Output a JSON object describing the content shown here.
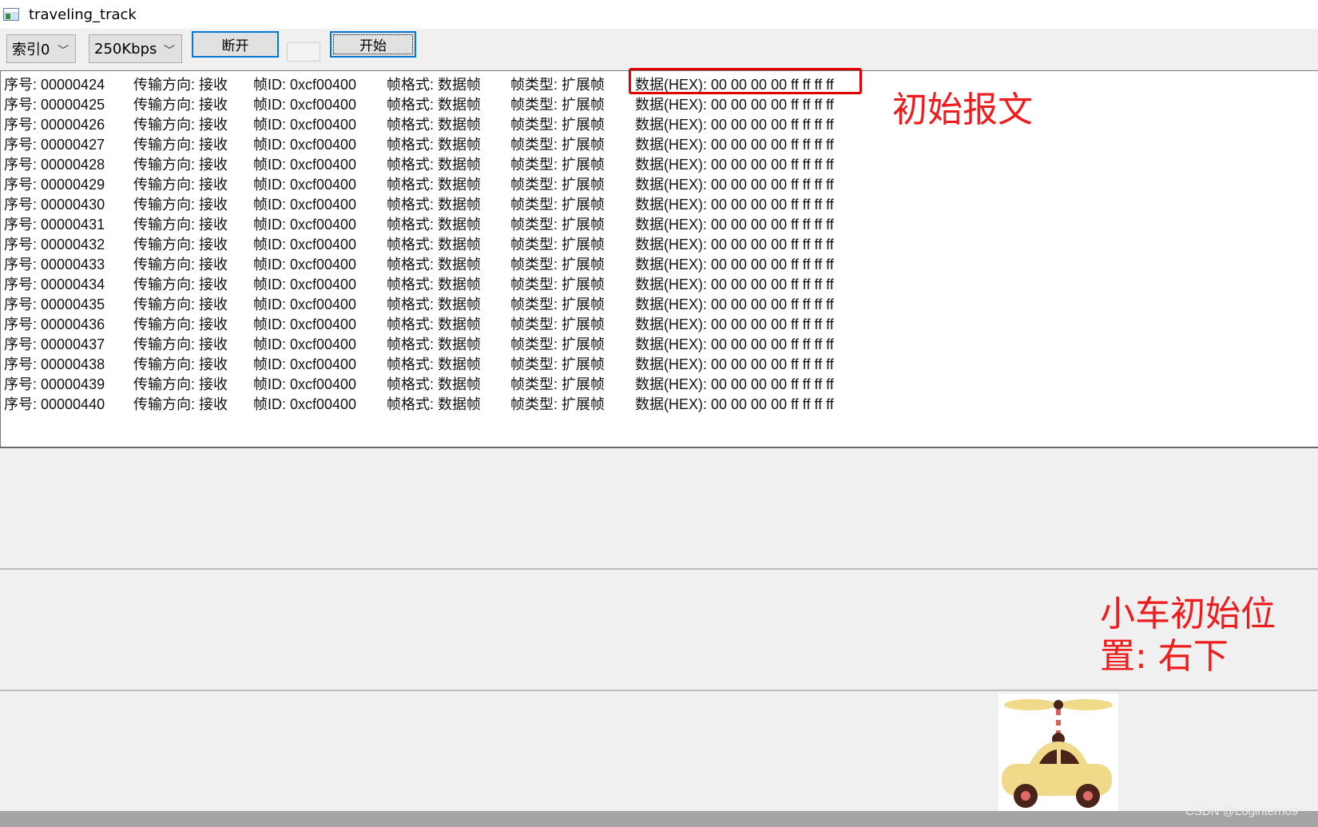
{
  "window": {
    "title": "traveling_track"
  },
  "toolbar": {
    "index_select": "索引0",
    "baud_select": "250Kbps",
    "disconnect_label": "断开",
    "start_label": "开始"
  },
  "log": {
    "rows": [
      {
        "seq": "序号: 00000424",
        "dir": "传输方向: 接收",
        "id": "帧ID: 0xcf00400",
        "fmt": "帧格式: 数据帧",
        "type": "帧类型: 扩展帧",
        "data": "数据(HEX): 00 00 00 00 ff ff ff ff"
      },
      {
        "seq": "序号: 00000425",
        "dir": "传输方向: 接收",
        "id": "帧ID: 0xcf00400",
        "fmt": "帧格式: 数据帧",
        "type": "帧类型: 扩展帧",
        "data": "数据(HEX): 00 00 00 00 ff ff ff ff"
      },
      {
        "seq": "序号: 00000426",
        "dir": "传输方向: 接收",
        "id": "帧ID: 0xcf00400",
        "fmt": "帧格式: 数据帧",
        "type": "帧类型: 扩展帧",
        "data": "数据(HEX): 00 00 00 00 ff ff ff ff"
      },
      {
        "seq": "序号: 00000427",
        "dir": "传输方向: 接收",
        "id": "帧ID: 0xcf00400",
        "fmt": "帧格式: 数据帧",
        "type": "帧类型: 扩展帧",
        "data": "数据(HEX): 00 00 00 00 ff ff ff ff"
      },
      {
        "seq": "序号: 00000428",
        "dir": "传输方向: 接收",
        "id": "帧ID: 0xcf00400",
        "fmt": "帧格式: 数据帧",
        "type": "帧类型: 扩展帧",
        "data": "数据(HEX): 00 00 00 00 ff ff ff ff"
      },
      {
        "seq": "序号: 00000429",
        "dir": "传输方向: 接收",
        "id": "帧ID: 0xcf00400",
        "fmt": "帧格式: 数据帧",
        "type": "帧类型: 扩展帧",
        "data": "数据(HEX): 00 00 00 00 ff ff ff ff"
      },
      {
        "seq": "序号: 00000430",
        "dir": "传输方向: 接收",
        "id": "帧ID: 0xcf00400",
        "fmt": "帧格式: 数据帧",
        "type": "帧类型: 扩展帧",
        "data": "数据(HEX): 00 00 00 00 ff ff ff ff"
      },
      {
        "seq": "序号: 00000431",
        "dir": "传输方向: 接收",
        "id": "帧ID: 0xcf00400",
        "fmt": "帧格式: 数据帧",
        "type": "帧类型: 扩展帧",
        "data": "数据(HEX): 00 00 00 00 ff ff ff ff"
      },
      {
        "seq": "序号: 00000432",
        "dir": "传输方向: 接收",
        "id": "帧ID: 0xcf00400",
        "fmt": "帧格式: 数据帧",
        "type": "帧类型: 扩展帧",
        "data": "数据(HEX): 00 00 00 00 ff ff ff ff"
      },
      {
        "seq": "序号: 00000433",
        "dir": "传输方向: 接收",
        "id": "帧ID: 0xcf00400",
        "fmt": "帧格式: 数据帧",
        "type": "帧类型: 扩展帧",
        "data": "数据(HEX): 00 00 00 00 ff ff ff ff"
      },
      {
        "seq": "序号: 00000434",
        "dir": "传输方向: 接收",
        "id": "帧ID: 0xcf00400",
        "fmt": "帧格式: 数据帧",
        "type": "帧类型: 扩展帧",
        "data": "数据(HEX): 00 00 00 00 ff ff ff ff"
      },
      {
        "seq": "序号: 00000435",
        "dir": "传输方向: 接收",
        "id": "帧ID: 0xcf00400",
        "fmt": "帧格式: 数据帧",
        "type": "帧类型: 扩展帧",
        "data": "数据(HEX): 00 00 00 00 ff ff ff ff"
      },
      {
        "seq": "序号: 00000436",
        "dir": "传输方向: 接收",
        "id": "帧ID: 0xcf00400",
        "fmt": "帧格式: 数据帧",
        "type": "帧类型: 扩展帧",
        "data": "数据(HEX): 00 00 00 00 ff ff ff ff"
      },
      {
        "seq": "序号: 00000437",
        "dir": "传输方向: 接收",
        "id": "帧ID: 0xcf00400",
        "fmt": "帧格式: 数据帧",
        "type": "帧类型: 扩展帧",
        "data": "数据(HEX): 00 00 00 00 ff ff ff ff"
      },
      {
        "seq": "序号: 00000438",
        "dir": "传输方向: 接收",
        "id": "帧ID: 0xcf00400",
        "fmt": "帧格式: 数据帧",
        "type": "帧类型: 扩展帧",
        "data": "数据(HEX): 00 00 00 00 ff ff ff ff"
      },
      {
        "seq": "序号: 00000439",
        "dir": "传输方向: 接收",
        "id": "帧ID: 0xcf00400",
        "fmt": "帧格式: 数据帧",
        "type": "帧类型: 扩展帧",
        "data": "数据(HEX): 00 00 00 00 ff ff ff ff"
      },
      {
        "seq": "序号: 00000440",
        "dir": "传输方向: 接收",
        "id": "帧ID: 0xcf00400",
        "fmt": "帧格式: 数据帧",
        "type": "帧类型: 扩展帧",
        "data": "数据(HEX): 00 00 00 00 ff ff ff ff"
      }
    ]
  },
  "annotations": {
    "initial_message": "初始报文",
    "car_position_line1": "小车初始位",
    "car_position_line2": "置: 右下",
    "color": "#ee1c1c"
  },
  "icons": {
    "app": "app-window-icon",
    "car": "propeller-car-icon"
  },
  "watermark": "CSDN @Logintern09"
}
